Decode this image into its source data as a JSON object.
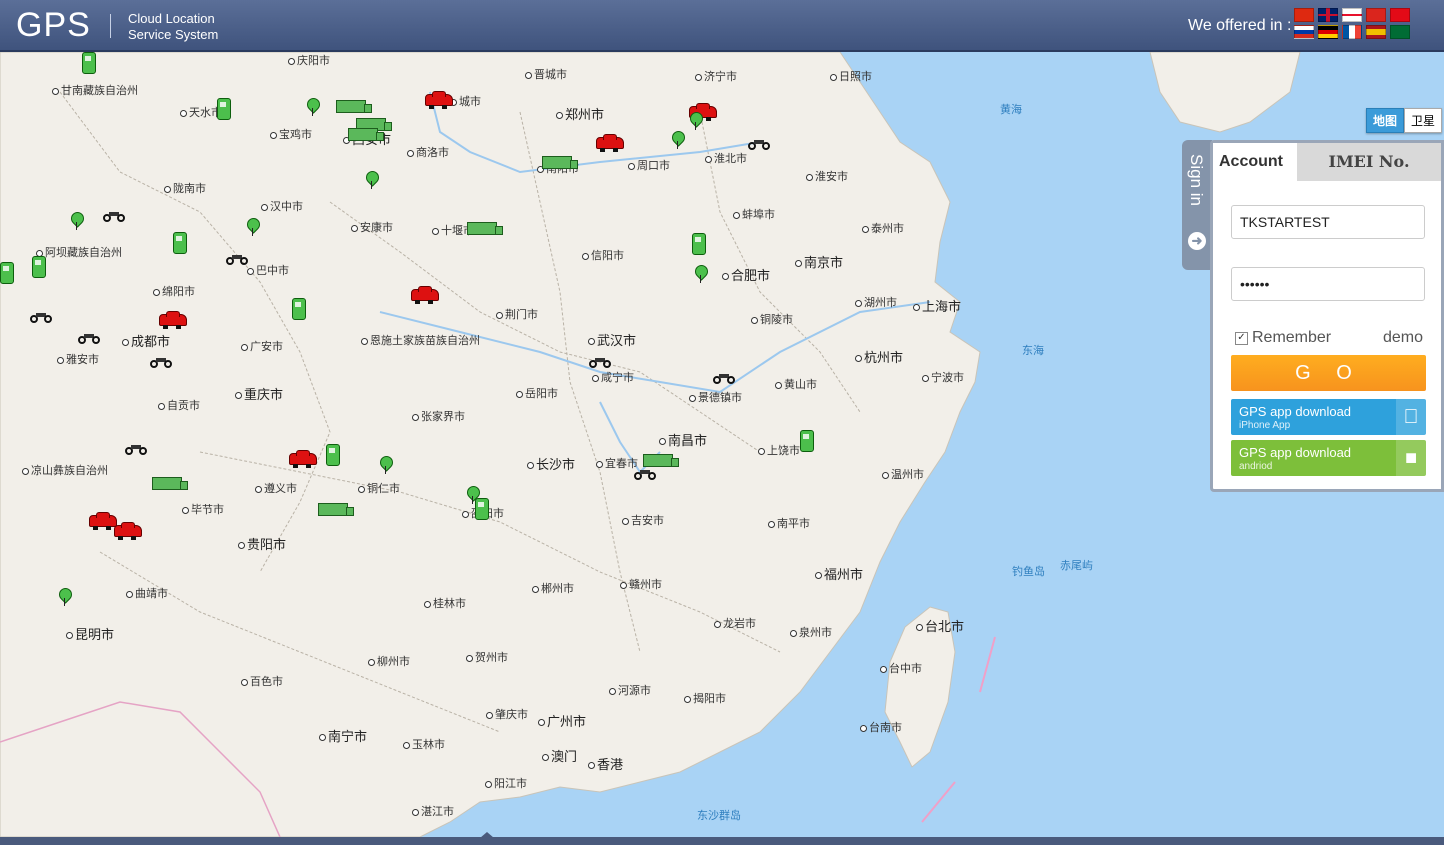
{
  "header": {
    "logo": "GPS",
    "tagline_line1": "Cloud Location",
    "tagline_line2": "Service System",
    "offered_label": "We offered in :",
    "flags": [
      "china-flag",
      "uk-flag",
      "georgia-flag",
      "vietnam-flag",
      "turkey-flag",
      "russia-flag",
      "germany-flag",
      "france-flag",
      "spain-flag",
      "saudi-flag"
    ]
  },
  "map_type": {
    "map": "地图",
    "satellite": "卫星"
  },
  "signin": {
    "side_label": "Sign in",
    "tab_account": "Account",
    "tab_imei": "IMEI No.",
    "username": "TKSTARTEST",
    "password": "••••••",
    "remember": "Remember",
    "demo": "demo",
    "go": "G O",
    "ios_title": "GPS app download",
    "ios_sub": "iPhone App",
    "android_title": "GPS app download",
    "android_sub": "andriod"
  },
  "map_labels": [
    "庆阳市",
    "晋城市",
    "济宁市",
    "日照市",
    "甘南藏族自治州",
    "天水市",
    "宝鸡市",
    "郑州市",
    "商洛市",
    "周口市",
    "淮北市",
    "淮安市",
    "陇南市",
    "汉中市",
    "安康市",
    "十堰市",
    "蚌埠市",
    "泰州市",
    "阿坝藏族自治州",
    "巴中市",
    "信阳市",
    "合肥市",
    "南京市",
    "绵阳市",
    "荆门市",
    "湖州市",
    "上海市",
    "铜陵市",
    "成都市",
    "广安市",
    "恩施土家族苗族自治州",
    "武汉市",
    "咸宁市",
    "杭州市",
    "雅安市",
    "重庆市",
    "岳阳市",
    "黄山市",
    "宁波市",
    "景德镇市",
    "自贡市",
    "张家界市",
    "南昌市",
    "上饶市",
    "凉山彝族自治州",
    "长沙市",
    "宜春市",
    "温州市",
    "遵义市",
    "铜仁市",
    "毕节市",
    "邵阳市",
    "吉安市",
    "南平市",
    "贵阳市",
    "福州市",
    "郴州市",
    "赣州市",
    "曲靖市",
    "桂林市",
    "龙岩市",
    "泉州市",
    "台北市",
    "昆明市",
    "柳州市",
    "贺州市",
    "台中市",
    "河源市",
    "揭阳市",
    "百色市",
    "肇庆市",
    "广州市",
    "南宁市",
    "玉林市",
    "澳门",
    "香港",
    "台南市",
    "阳江市",
    "湛江市",
    "黄海",
    "东海",
    "钓鱼岛",
    "赤尾屿",
    "东沙群岛",
    "城市",
    "西安市",
    "南阳市"
  ]
}
